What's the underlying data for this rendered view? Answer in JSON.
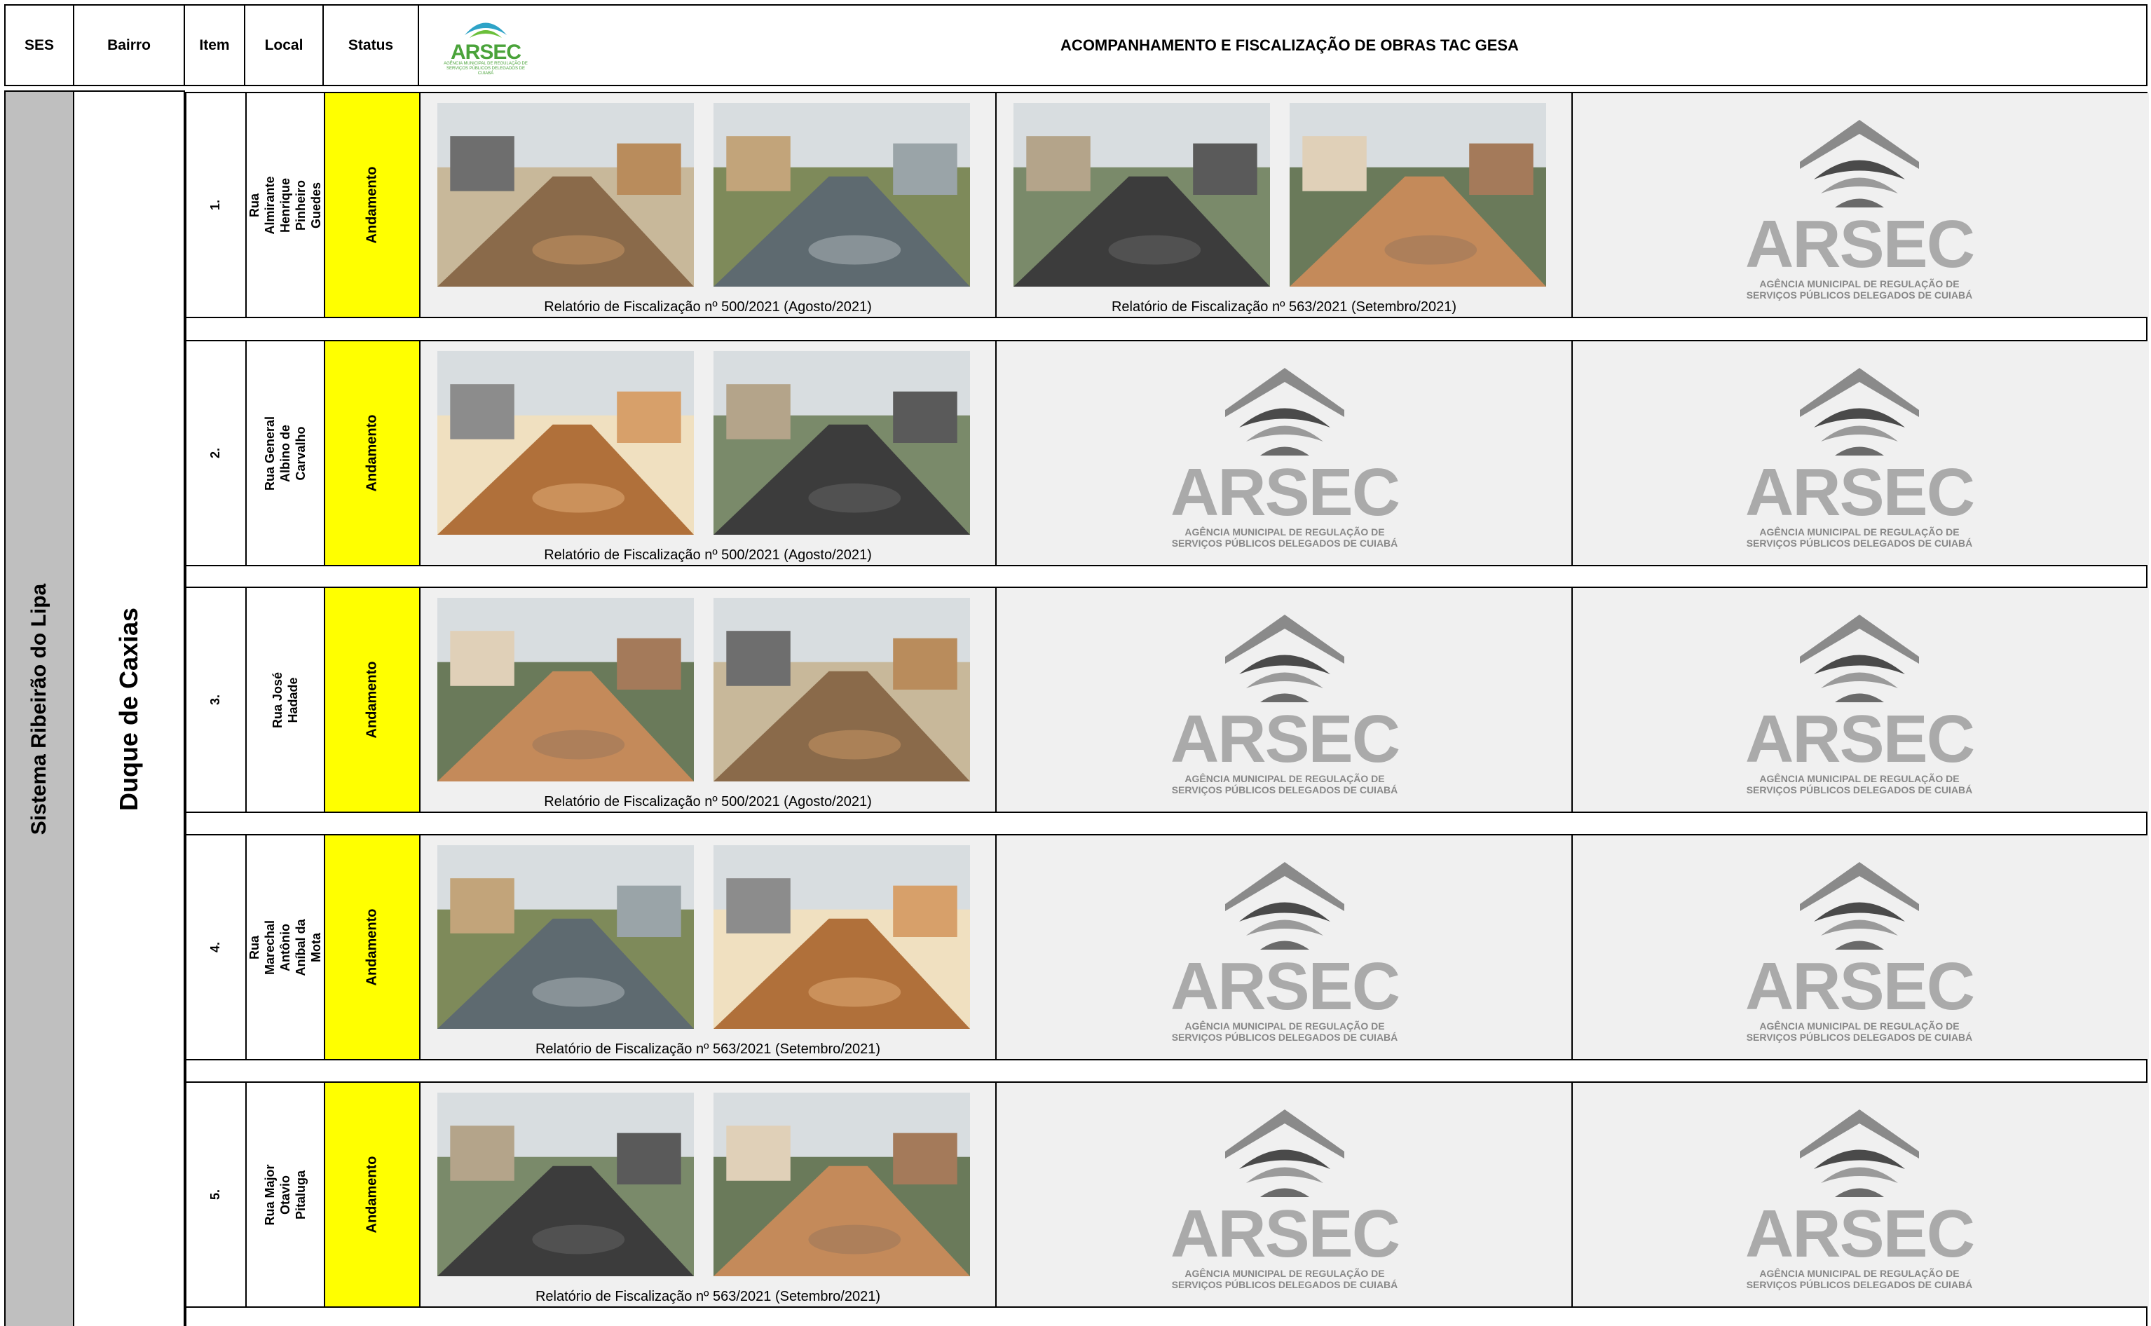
{
  "header": {
    "col_ses": "SES",
    "col_bairro": "Bairro",
    "col_item": "Item",
    "col_local": "Local",
    "col_status": "Status",
    "logo_text": "ARSEC",
    "logo_sub": "AGÊNCIA MUNICIPAL DE REGULAÇÃO DE SERVIÇOS PÚBLICOS DELEGADOS DE CUIABÁ",
    "title": "ACOMPANHAMENTO E FISCALIZAÇÃO DE OBRAS TAC GESA"
  },
  "ses": "Sistema Ribeirão do Lipa",
  "bairro": "Duque de Caxias",
  "placeholder": {
    "logo_text": "ARSEC",
    "line1": "AGÊNCIA MUNICIPAL DE REGULAÇÃO DE",
    "line2": "SERVIÇOS PÚBLICOS DELEGADOS DE CUIABÁ"
  },
  "rows": [
    {
      "item": "1.",
      "local": "Rua Almirante Henrique Pinheiro Guedes",
      "status": "Andamento",
      "report1": "Relatório de Fiscalização nº 500/2021 (Agosto/2021)",
      "report2": "Relatório de Fiscalização nº 563/2021 (Setembro/2021)"
    },
    {
      "item": "2.",
      "local": "Rua General Albino de Carvalho",
      "status": "Andamento",
      "report1": "Relatório de Fiscalização nº 500/2021 (Agosto/2021)"
    },
    {
      "item": "3.",
      "local": "Rua José Hadade",
      "status": "Andamento",
      "report1": "Relatório de Fiscalização nº 500/2021 (Agosto/2021)"
    },
    {
      "item": "4.",
      "local": "Rua Marechal Antônio Aníbal da Mota",
      "status": "Andamento",
      "report1": "Relatório de Fiscalização nº 563/2021 (Setembro/2021)"
    },
    {
      "item": "5.",
      "local": "Rua Major Otavio Pitaluga",
      "status": "Andamento",
      "report1": "Relatório de Fiscalização nº 563/2021 (Setembro/2021)"
    }
  ],
  "colors": {
    "status_bg": "#ffff00",
    "ses_bg": "#bfbfbf",
    "photo_bg": "#f0f0f0"
  }
}
